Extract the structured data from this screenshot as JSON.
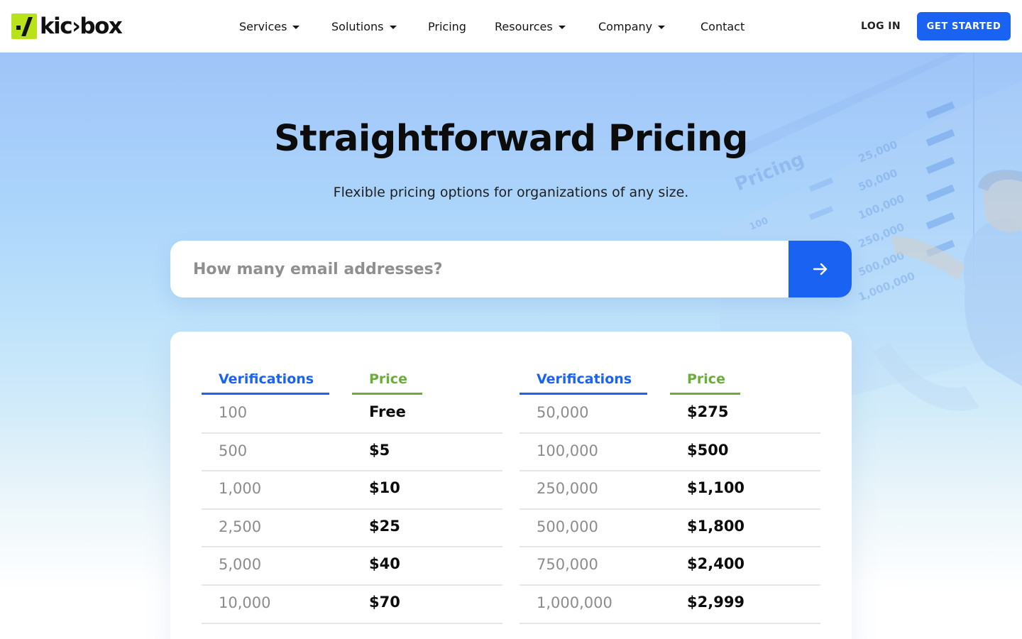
{
  "brand": {
    "name": "kickbox",
    "logo_text": "kic›box",
    "accent": "#b9e21a"
  },
  "nav": {
    "items": [
      {
        "label": "Services",
        "dropdown": true
      },
      {
        "label": "Solutions",
        "dropdown": true
      },
      {
        "label": "Pricing",
        "dropdown": false
      },
      {
        "label": "Resources",
        "dropdown": true
      },
      {
        "label": "Company",
        "dropdown": true
      },
      {
        "label": "Contact",
        "dropdown": false
      }
    ],
    "login_label": "LOG IN",
    "cta_label": "GET STARTED",
    "cta_color": "#1a63f2"
  },
  "hero": {
    "title": "Straightforward Pricing",
    "subtitle": "Flexible pricing options for organizations of any size.",
    "search": {
      "placeholder": "How many email addresses?",
      "value": ""
    },
    "illustration": {
      "heading": "Pricing",
      "values": [
        "25,000",
        "50,000",
        "100,000",
        "250,000",
        "500,000",
        "1,000,000"
      ],
      "row_label": "100"
    }
  },
  "pricing": {
    "verifications_header": "Verifications",
    "price_header": "Price",
    "header_colors": {
      "verifications": "#1a63f2",
      "price": "#6aad3a"
    },
    "left": [
      {
        "verifications": "100",
        "price": "Free"
      },
      {
        "verifications": "500",
        "price": "$5"
      },
      {
        "verifications": "1,000",
        "price": "$10"
      },
      {
        "verifications": "2,500",
        "price": "$25"
      },
      {
        "verifications": "5,000",
        "price": "$40"
      },
      {
        "verifications": "10,000",
        "price": "$70"
      }
    ],
    "right": [
      {
        "verifications": "50,000",
        "price": "$275"
      },
      {
        "verifications": "100,000",
        "price": "$500"
      },
      {
        "verifications": "250,000",
        "price": "$1,100"
      },
      {
        "verifications": "500,000",
        "price": "$1,800"
      },
      {
        "verifications": "750,000",
        "price": "$2,400"
      },
      {
        "verifications": "1,000,000",
        "price": "$2,999"
      }
    ]
  }
}
